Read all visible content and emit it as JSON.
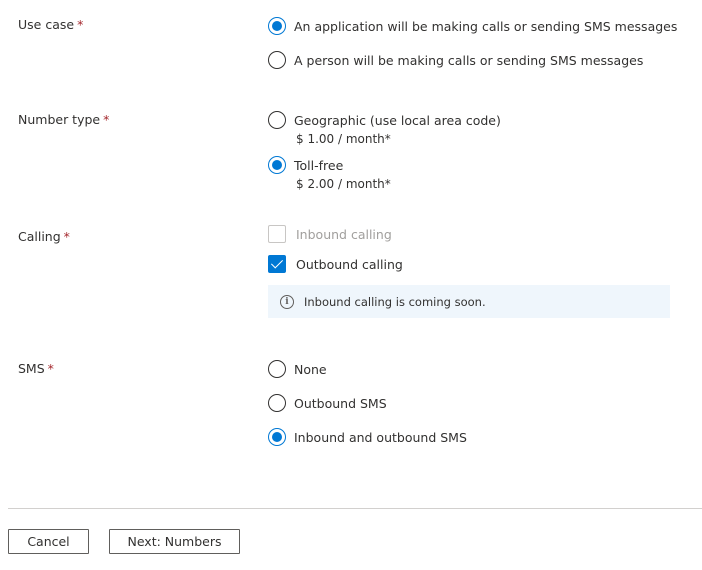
{
  "required_marker": "*",
  "use_case": {
    "label": "Use case",
    "options": [
      {
        "text": "An application will be making calls or sending SMS messages",
        "selected": true
      },
      {
        "text": "A person will be making calls or sending SMS messages",
        "selected": false
      }
    ]
  },
  "number_type": {
    "label": "Number type",
    "options": [
      {
        "text": "Geographic (use local area code)",
        "price": "$ 1.00 / month*",
        "selected": false
      },
      {
        "text": "Toll-free",
        "price": "$ 2.00 / month*",
        "selected": true
      }
    ]
  },
  "calling": {
    "label": "Calling",
    "options": [
      {
        "text": "Inbound calling",
        "checked": false,
        "disabled": true
      },
      {
        "text": "Outbound calling",
        "checked": true,
        "disabled": false
      }
    ],
    "info": "Inbound calling is coming soon."
  },
  "sms": {
    "label": "SMS",
    "options": [
      {
        "text": "None",
        "selected": false
      },
      {
        "text": "Outbound SMS",
        "selected": false
      },
      {
        "text": "Inbound and outbound SMS",
        "selected": true
      }
    ]
  },
  "footer": {
    "cancel_label": "Cancel",
    "next_label": "Next: Numbers"
  },
  "colors": {
    "accent": "#0078d4",
    "required": "#a4262c",
    "info_bg": "#eff6fc"
  }
}
